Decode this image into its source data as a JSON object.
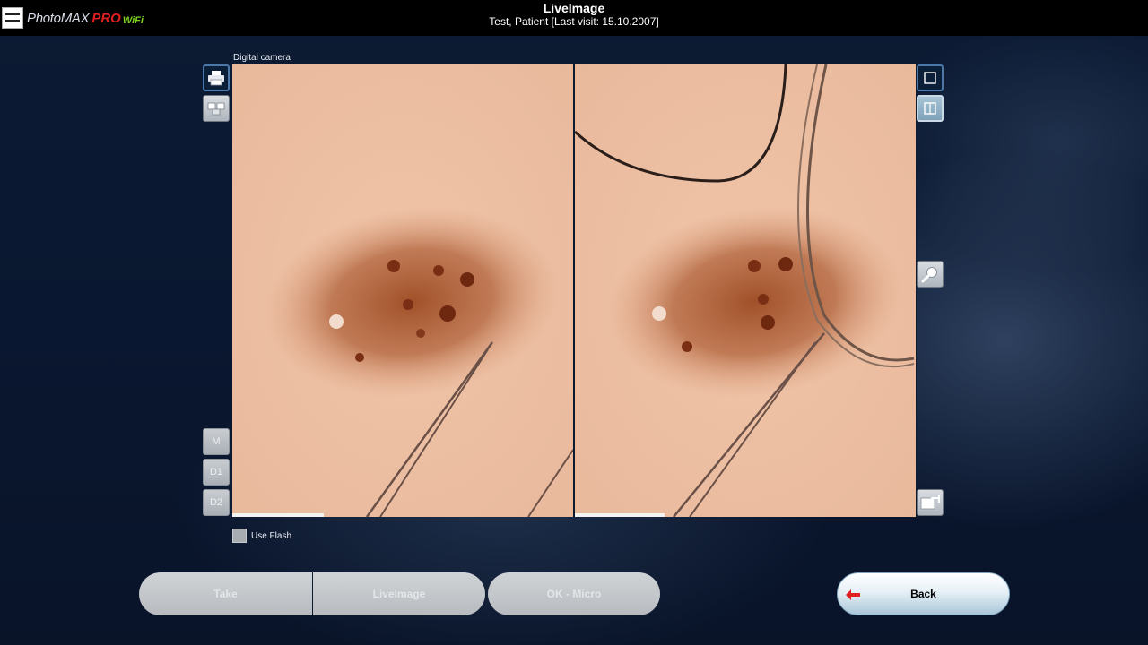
{
  "app": {
    "logo_text": "PhotoMAX",
    "logo_pro": "PRO",
    "logo_wifi": "WiFi",
    "title": "LiveImage",
    "subtitle": "Test, Patient [Last visit: 15.10.2007]"
  },
  "viewer": {
    "caption": "Digital camera"
  },
  "left_toolbar": {
    "marker_m": "M",
    "marker_d1": "D1",
    "marker_d2": "D2"
  },
  "options": {
    "use_flash_label": "Use Flash",
    "use_flash_checked": false
  },
  "bottom_bar": {
    "take_label": "Take",
    "liveimage_label": "LiveImage",
    "ok_micro_label": "OK - Micro",
    "back_label": "Back"
  },
  "icons": {
    "print": "printer-icon",
    "compare": "compare-icon",
    "single_view": "single-view-icon",
    "split_view": "split-view-icon",
    "zoom": "magnifier-icon",
    "export": "export-icon",
    "back": "back-arrow-icon"
  },
  "colors": {
    "accent_active": "#4b78a8",
    "back_arrow": "#e02020"
  }
}
